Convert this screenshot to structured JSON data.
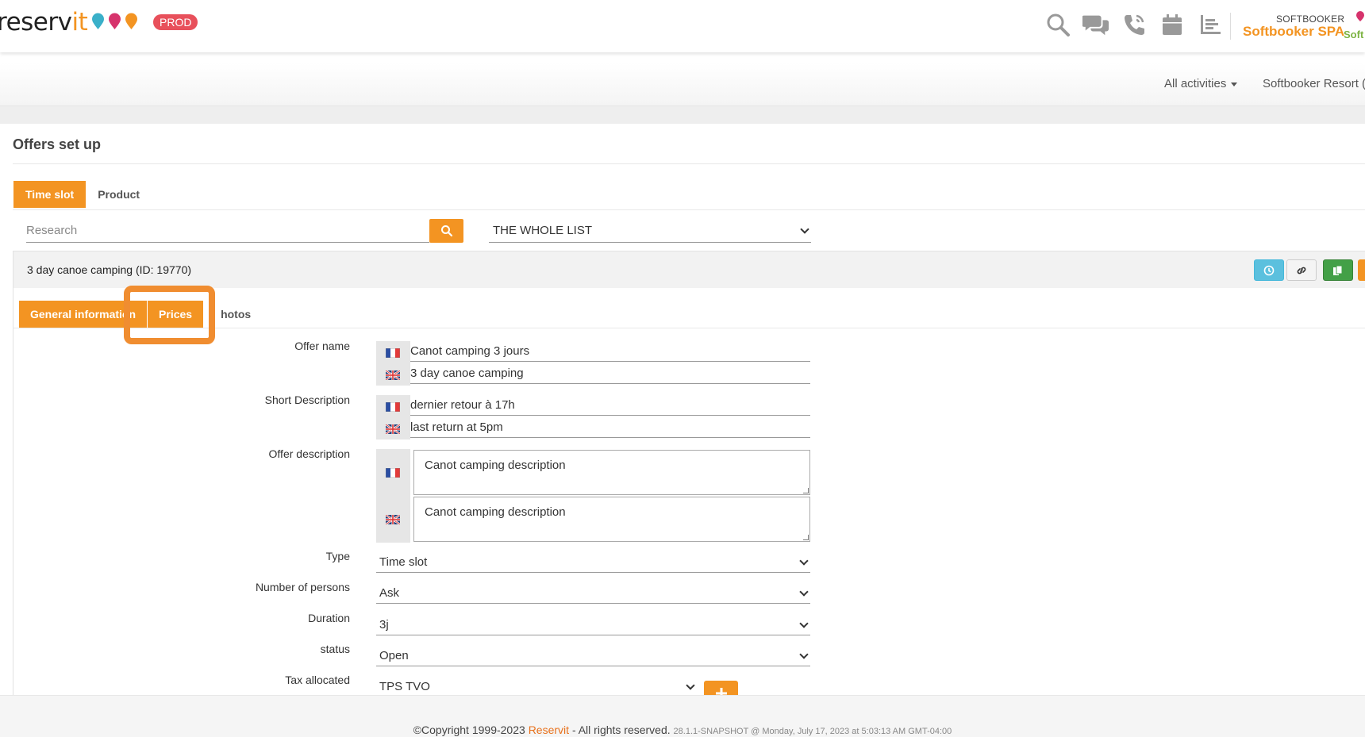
{
  "header": {
    "logo_text": "reserv",
    "logo_accent": "it",
    "env_badge": "PROD",
    "brand_small": "SOFTBOOKER",
    "brand_name": "Softbooker SPA",
    "brand_logo_text": "Soft",
    "icons": [
      "search-icon",
      "chat-icon",
      "phone-icon",
      "calendar-icon",
      "list-icon"
    ],
    "accent_color": "#f39422"
  },
  "subbar": {
    "activities_label": "All activities",
    "resort_label": "Softbooker Resort ("
  },
  "page": {
    "title": "Offers set up",
    "tabs": [
      {
        "label": "Time slot",
        "active": true
      },
      {
        "label": "Product",
        "active": false
      }
    ]
  },
  "search": {
    "placeholder": "Research",
    "value": "",
    "list_filter": "THE WHOLE LIST"
  },
  "offer": {
    "title": "3 day canoe camping (ID: 19770)",
    "tabs": [
      {
        "label": "General information",
        "active": true
      },
      {
        "label": "Prices",
        "active": true
      },
      {
        "label": "hotos",
        "active": false
      }
    ],
    "labels": {
      "offer_name": "Offer name",
      "short_description": "Short Description",
      "offer_description": "Offer description",
      "type": "Type",
      "persons": "Number of persons",
      "duration": "Duration",
      "status": "status",
      "tax": "Tax allocated"
    },
    "offer_name_fr": "Canot camping 3 jours",
    "offer_name_en": "3 day canoe camping",
    "short_desc_fr": "dernier retour à 17h",
    "short_desc_en": "last return at 5pm",
    "desc_fr": "Canot camping description",
    "desc_en": "Canot camping description",
    "type": "Time slot",
    "persons": "Ask",
    "duration": "3j",
    "status": "Open",
    "tax": "TPS TVO"
  },
  "footer": {
    "copyright": "©Copyright 1999-2023",
    "company": "Reservit",
    "rights": "- All rights reserved.",
    "version": "28.1.1-SNAPSHOT @ Monday, July 17, 2023 at 5:03:13 AM GMT-04:00"
  }
}
